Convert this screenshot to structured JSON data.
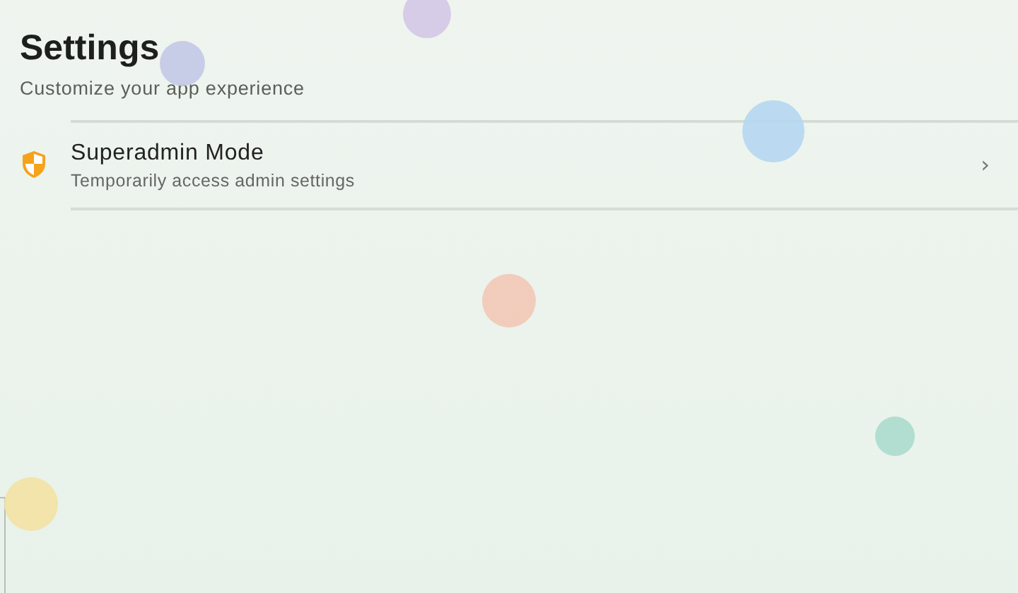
{
  "header": {
    "title": "Settings",
    "subtitle": "Customize your app experience"
  },
  "items": [
    {
      "kind": "link",
      "title": "Superadmin Mode",
      "description": "Temporarily access admin settings",
      "chevron": "›"
    }
  ]
}
